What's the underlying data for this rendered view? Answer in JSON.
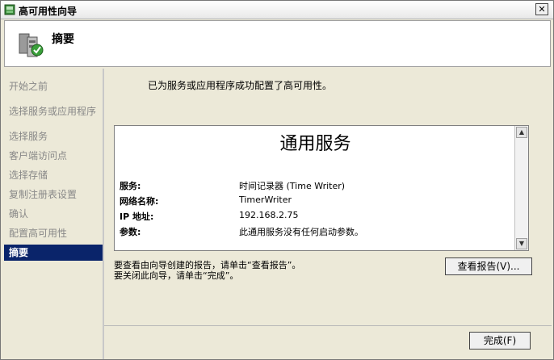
{
  "window": {
    "title": "高可用性向导",
    "close_label": "✕"
  },
  "header": {
    "title": "摘要"
  },
  "sidebar": {
    "items": [
      {
        "label": "开始之前"
      },
      {
        "label": "选择服务或应用程序"
      },
      {
        "label": "选择服务"
      },
      {
        "label": "客户端访问点"
      },
      {
        "label": "选择存储"
      },
      {
        "label": "复制注册表设置"
      },
      {
        "label": "确认"
      },
      {
        "label": "配置高可用性"
      },
      {
        "label": "摘要"
      }
    ]
  },
  "main": {
    "success_text": "已为服务或应用程序成功配置了高可用性。",
    "report": {
      "title": "通用服务",
      "rows": [
        {
          "label": "服务:",
          "value": "时间记录器 (Time Writer)"
        },
        {
          "label": "网络名称:",
          "value": "TimerWriter"
        },
        {
          "label": "IP 地址:",
          "value": "192.168.2.75"
        },
        {
          "label": "参数:",
          "value": "此通用服务没有任何启动参数。"
        }
      ]
    },
    "hint_line1": "要查看由向导创建的报告，请单击“查看报告”。",
    "hint_line2": "要关闭此向导，请单击“完成”。",
    "view_report_button": "查看报告(V)...",
    "finish_button": "完成(F)"
  }
}
